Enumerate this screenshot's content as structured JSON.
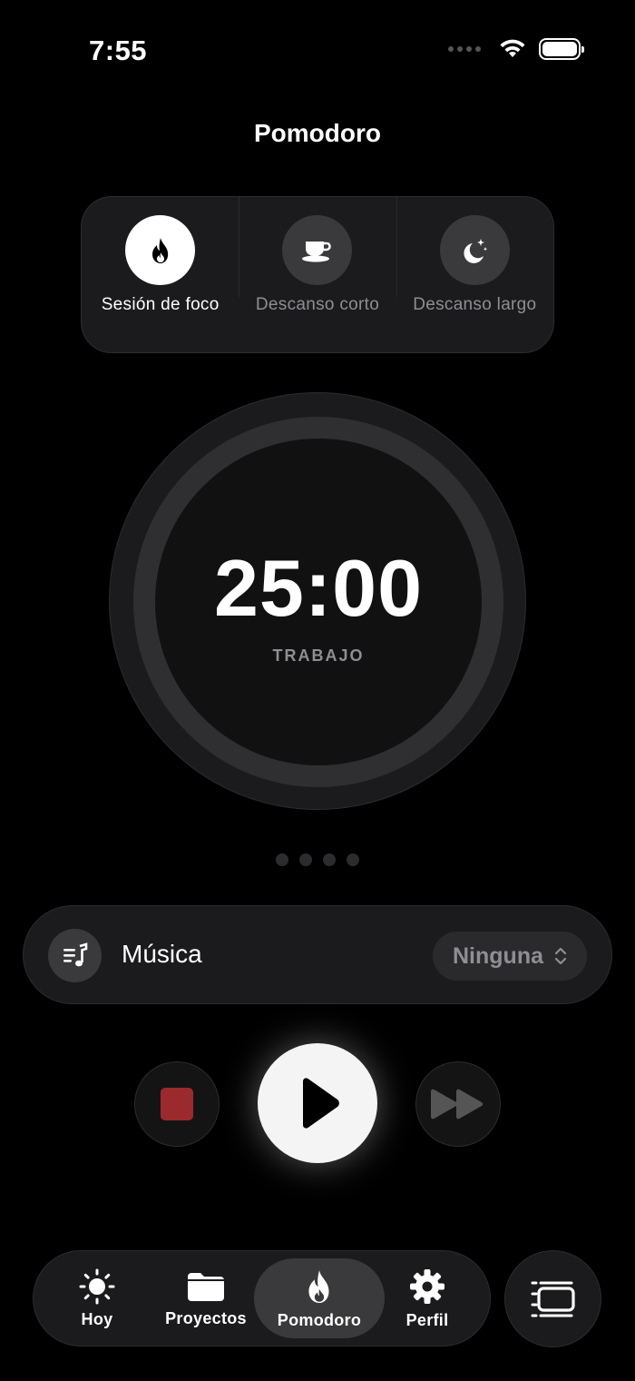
{
  "status_bar": {
    "time": "7:55"
  },
  "header": {
    "title": "Pomodoro"
  },
  "modes": [
    {
      "label": "Sesión de foco",
      "icon": "flame-icon",
      "active": true
    },
    {
      "label": "Descanso corto",
      "icon": "coffee-cup-icon",
      "active": false
    },
    {
      "label": "Descanso largo",
      "icon": "moon-stars-icon",
      "active": false
    }
  ],
  "timer": {
    "value": "25:00",
    "label": "TRABAJO"
  },
  "page_indicator": {
    "count": 4
  },
  "music": {
    "label": "Música",
    "selected": "Ninguna",
    "icon": "music-list-icon"
  },
  "controls": {
    "stop_icon": "stop-icon",
    "play_icon": "play-icon",
    "skip_icon": "fast-forward-icon"
  },
  "tabbar": {
    "items": [
      {
        "label": "Hoy",
        "icon": "sun-icon"
      },
      {
        "label": "Proyectos",
        "icon": "folder-icon"
      },
      {
        "label": "Pomodoro",
        "icon": "flame-icon",
        "active": true
      },
      {
        "label": "Perfil",
        "icon": "gear-icon"
      }
    ],
    "side_button_icon": "layout-icon"
  },
  "colors": {
    "background": "#000000",
    "card": "#1b1b1d",
    "stop": "#9a2a2e",
    "accent": "#ffffff"
  }
}
